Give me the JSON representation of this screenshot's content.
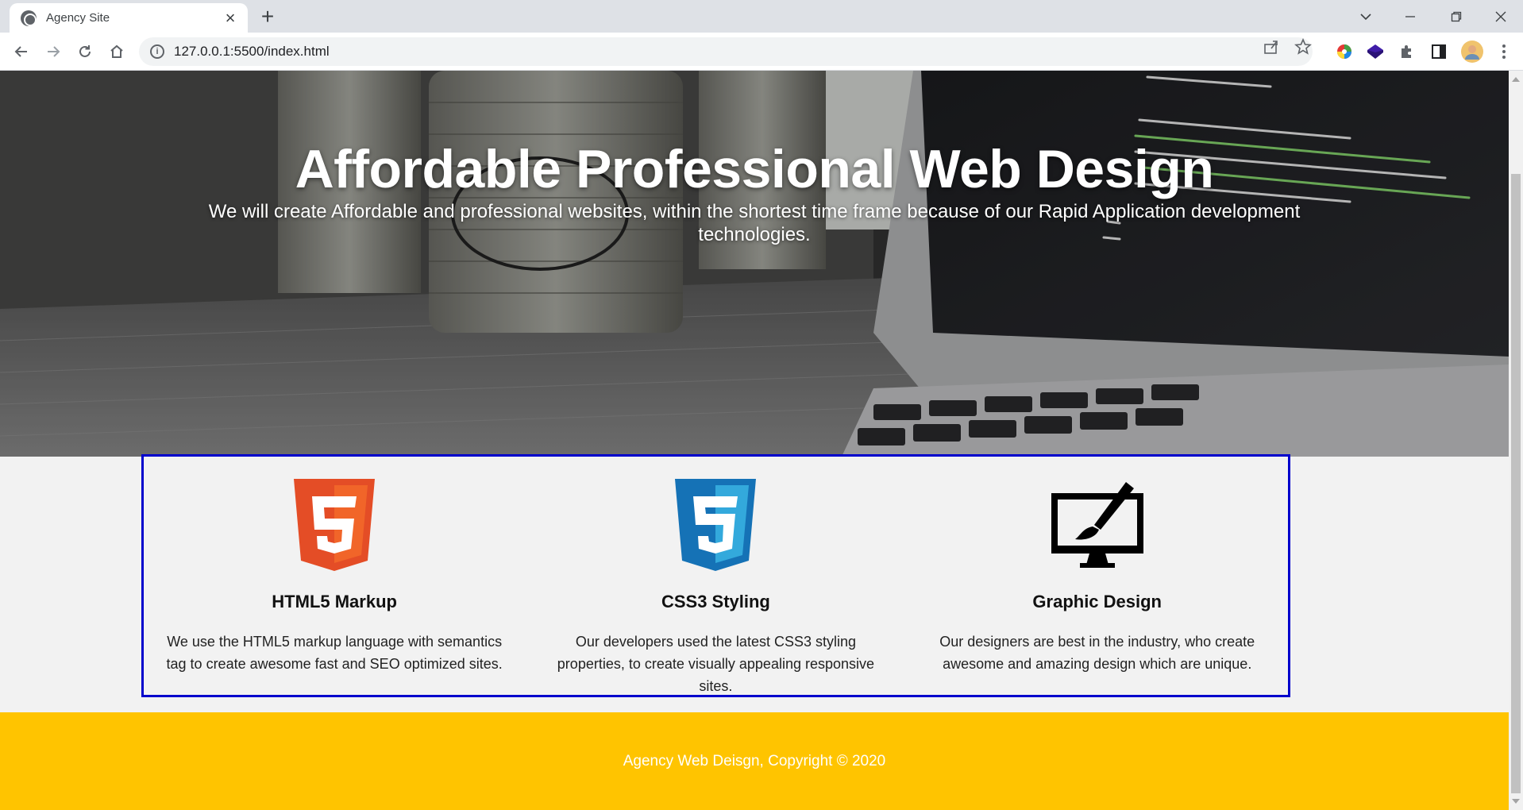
{
  "browser": {
    "tab_title": "Agency Site",
    "url": "127.0.0.1:5500/index.html",
    "new_tab": "+",
    "tab_close": "×"
  },
  "hero": {
    "title": "Affordable Professional Web Design",
    "subtitle": "We will create Affordable and professional websites, within the shortest time frame because of our Rapid Application development technologies."
  },
  "features": [
    {
      "icon": "html5-icon",
      "title": "HTML5 Markup",
      "text": "We use the HTML5 markup language with semantics tag to create awesome fast and SEO optimized sites."
    },
    {
      "icon": "css3-icon",
      "title": "CSS3 Styling",
      "text": "Our developers used the latest CSS3 styling properties, to create visually appealing responsive sites."
    },
    {
      "icon": "graphic-design-icon",
      "title": "Graphic Design",
      "text": "Our designers are best in the industry, who create awesome and amazing design which are unique."
    }
  ],
  "footer": {
    "text": "Agency Web Deisgn, Copyright © 2020"
  },
  "colors": {
    "footer_bg": "#ffc400",
    "features_border": "#0000cc",
    "html5_orange": "#e44d26",
    "css3_blue": "#1572b6"
  }
}
